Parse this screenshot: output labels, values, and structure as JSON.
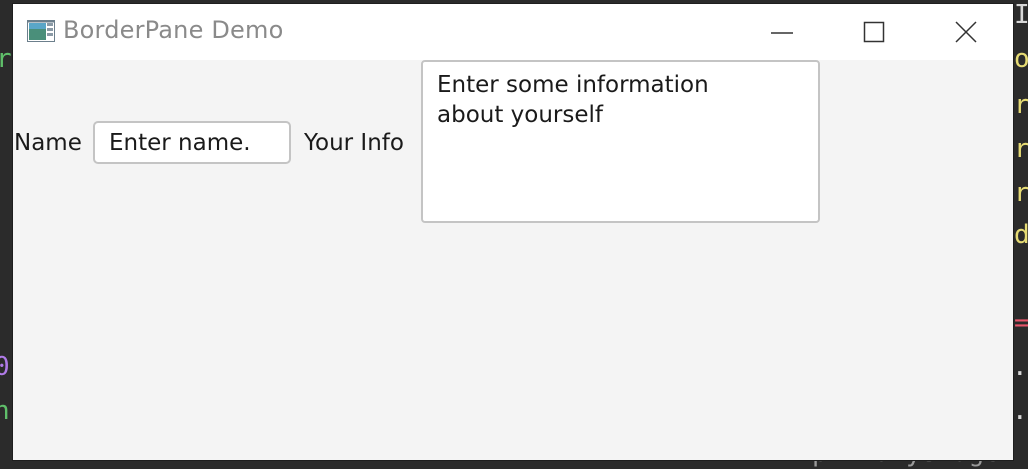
{
  "window": {
    "title": "BorderPane Demo",
    "controls": {
      "minimize": "minimize",
      "maximize": "maximize",
      "close": "close"
    }
  },
  "form": {
    "name_label": "Name",
    "name_value": "Enter name.",
    "info_label": "Your Info",
    "info_value": "Enter some information\nabout yourself"
  },
  "background_code": {
    "lines": [
      "Ir",
      "r",
      "ou",
      "re",
      "re",
      "re",
      "dr",
      "=",
      "0",
      ". s",
      "nc",
      ". s",
      "primaryStage"
    ]
  },
  "colors": {
    "window_bg": "#f4f4f4",
    "titlebar_bg": "#ffffff",
    "title_text": "#8a8a8a",
    "field_border": "#c4c4c4",
    "editor_bg": "#2b2b2b"
  }
}
